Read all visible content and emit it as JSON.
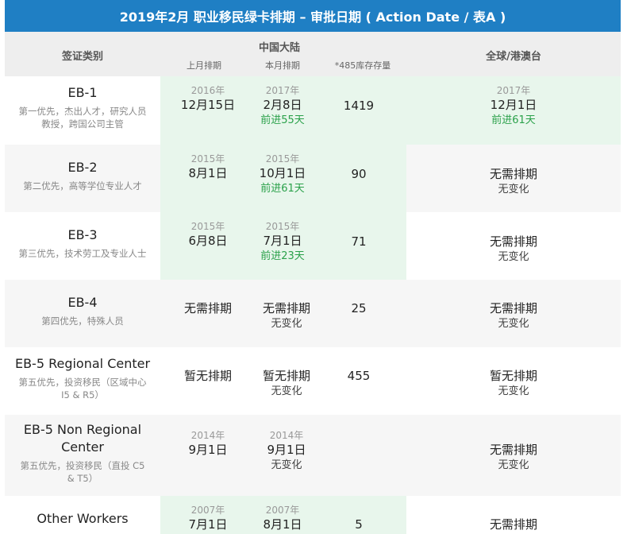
{
  "title": "2019年2月 职业移民绿卡排期 – 审批日期 ( Action Date / 表A )",
  "header": {
    "category": "签证类别",
    "china": "中国大陆",
    "last_month": "上月排期",
    "this_month": "本月排期",
    "inventory": "*485库存存量",
    "global": "全球/港澳台"
  },
  "rows": [
    {
      "name": "EB-1",
      "desc1": "第一优先，杰出人才，研究人员",
      "desc2": "教授，跨国公司主管",
      "last_year": "2016年",
      "last_date": "12月15日",
      "this_year": "2017年",
      "this_date": "2月8日",
      "this_change": "前进55天",
      "inventory": "1419",
      "global_year": "2017年",
      "global_date": "12月1日",
      "global_change": "前进61天"
    },
    {
      "name": "EB-2",
      "desc1": "第二优先，高等学位专业人才",
      "last_year": "2015年",
      "last_date": "8月1日",
      "this_year": "2015年",
      "this_date": "10月1日",
      "this_change": "前进61天",
      "inventory": "90",
      "global_date": "无需排期",
      "global_change": "无变化"
    },
    {
      "name": "EB-3",
      "desc1": "第三优先，技术劳工及专业人士",
      "last_year": "2015年",
      "last_date": "6月8日",
      "this_year": "2015年",
      "this_date": "7月1日",
      "this_change": "前进23天",
      "inventory": "71",
      "global_date": "无需排期",
      "global_change": "无变化"
    },
    {
      "name": "EB-4",
      "desc1": "第四优先，特殊人员",
      "last_date": "无需排期",
      "this_date": "无需排期",
      "this_change": "无变化",
      "inventory": "25",
      "global_date": "无需排期",
      "global_change": "无变化"
    },
    {
      "name": "EB-5 Regional Center",
      "desc1": "第五优先，投资移民（区域中心",
      "desc2": "I5 & R5）",
      "last_date": "暂无排期",
      "this_date": "暂无排期",
      "this_change": "无变化",
      "inventory": "455",
      "global_date": "暂无排期",
      "global_change": "无变化"
    },
    {
      "name1": "EB-5 Non Regional",
      "name2": "Center",
      "desc1": "第五优先，投资移民（直投 C5",
      "desc2": "& T5）",
      "last_year": "2014年",
      "last_date": "9月1日",
      "this_year": "2014年",
      "this_date": "9月1日",
      "this_change": "无变化",
      "global_date": "无需排期",
      "global_change": "无变化"
    },
    {
      "name": "Other Workers",
      "last_year": "2007年",
      "last_date": "7月1日",
      "this_year": "2007年",
      "this_date": "8月1日",
      "inventory": "5",
      "global_date": "无需排期"
    }
  ]
}
